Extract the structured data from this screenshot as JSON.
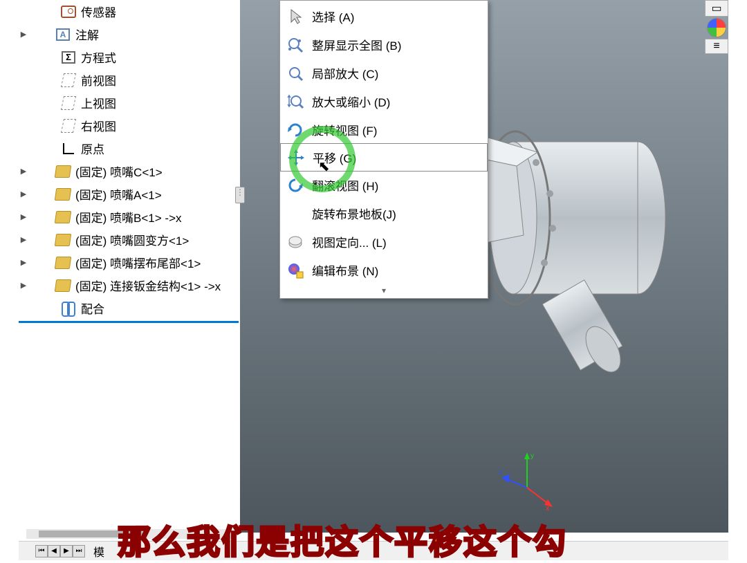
{
  "tree": {
    "items": [
      {
        "label": "传感器",
        "icon": "sensor",
        "expand": false
      },
      {
        "label": "注解",
        "icon": "annot",
        "expand": true
      },
      {
        "label": "方程式",
        "icon": "sigma",
        "expand": false
      },
      {
        "label": "前视图",
        "icon": "plane",
        "expand": false
      },
      {
        "label": "上视图",
        "icon": "plane",
        "expand": false
      },
      {
        "label": "右视图",
        "icon": "plane",
        "expand": false
      },
      {
        "label": "原点",
        "icon": "origin",
        "expand": false
      },
      {
        "label": "(固定) 喷嘴C<1>",
        "icon": "part",
        "expand": true
      },
      {
        "label": "(固定) 喷嘴A<1>",
        "icon": "part",
        "expand": true
      },
      {
        "label": "(固定) 喷嘴B<1> ->x",
        "icon": "part",
        "expand": true
      },
      {
        "label": "(固定) 喷嘴圆变方<1>",
        "icon": "part",
        "expand": true
      },
      {
        "label": "(固定) 喷嘴摆布尾部<1>",
        "icon": "part",
        "expand": true
      },
      {
        "label": "(固定) 连接钣金结构<1> ->x",
        "icon": "part",
        "expand": true
      },
      {
        "label": "配合",
        "icon": "mate",
        "expand": false
      }
    ]
  },
  "menu": {
    "items": [
      {
        "label": "选择 (A)",
        "icon": "cursor"
      },
      {
        "label": "整屏显示全图 (B)",
        "icon": "zoomfit"
      },
      {
        "label": "局部放大 (C)",
        "icon": "zoomarea"
      },
      {
        "label": "放大或缩小 (D)",
        "icon": "zoom"
      },
      {
        "label": "旋转视图 (F)",
        "icon": "rotate"
      },
      {
        "label": "平移 (G)",
        "icon": "pan",
        "selected": true
      },
      {
        "label": "翻滚视图 (H)",
        "icon": "roll"
      },
      {
        "label": "旋转布景地板(J)",
        "icon": "none"
      },
      {
        "label": "视图定向... (L)",
        "icon": "orient"
      },
      {
        "label": "编辑布景 (N)",
        "icon": "editscene"
      }
    ],
    "more": "▾"
  },
  "triad": {
    "x": "x",
    "y": "y",
    "z": "z"
  },
  "subtitle": "那么我们是把这个平移这个勾",
  "bottom_tab": "模"
}
